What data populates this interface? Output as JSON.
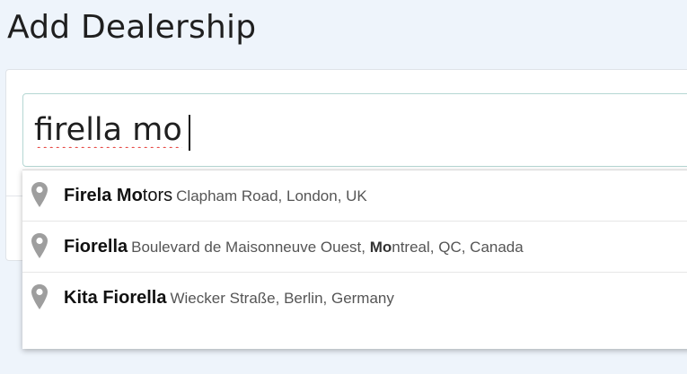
{
  "page": {
    "title": "Add Dealership"
  },
  "search": {
    "value": "firella mo"
  },
  "suggestions": [
    {
      "icon": "map-pin-icon",
      "name_bold": "Firela Mo",
      "name_rest": "tors",
      "address_parts": [
        "Clapham Road, London, UK"
      ]
    },
    {
      "icon": "map-pin-icon",
      "name_bold": "Fiorella",
      "name_rest": "",
      "address_parts": [
        "Boulevard de Maisonneuve Ouest, ",
        "Mo",
        "ntreal, QC, Canada"
      ]
    },
    {
      "icon": "map-pin-icon",
      "name_bold": "Kita Fiorella",
      "name_rest": "",
      "address_parts": [
        "Wiecker Straße, Berlin, Germany"
      ]
    }
  ],
  "colors": {
    "background": "#eef4fb",
    "input_border": "#b5d7d3",
    "pin_icon": "#9e9e9e",
    "spellcheck_underline": "#e53935"
  }
}
